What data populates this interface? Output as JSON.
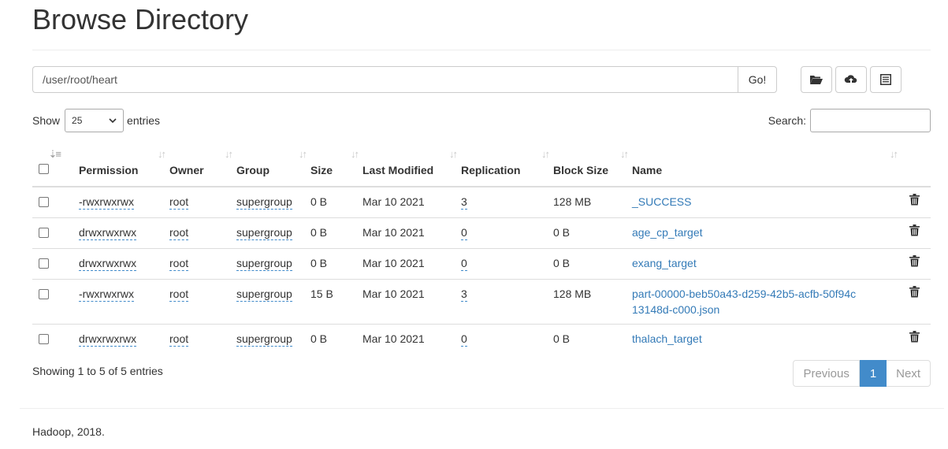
{
  "header": {
    "title": "Browse Directory"
  },
  "path": {
    "value": "/user/root/heart",
    "go_label": "Go!"
  },
  "toolbar": {
    "buttons": [
      {
        "icon": "folder-open-icon"
      },
      {
        "icon": "cloud-upload-icon"
      },
      {
        "icon": "list-alt-icon"
      }
    ]
  },
  "length": {
    "show_label": "Show",
    "selected": "25",
    "entries_label": "entries"
  },
  "search": {
    "label": "Search:",
    "value": ""
  },
  "table": {
    "columns": [
      "Permission",
      "Owner",
      "Group",
      "Size",
      "Last Modified",
      "Replication",
      "Block Size",
      "Name"
    ],
    "rows": [
      {
        "permission": "-rwxrwxrwx",
        "owner": "root",
        "group": "supergroup",
        "size": "0 B",
        "modified": "Mar 10 2021",
        "replication": "3",
        "block_size": "128 MB",
        "name": "_SUCCESS"
      },
      {
        "permission": "drwxrwxrwx",
        "owner": "root",
        "group": "supergroup",
        "size": "0 B",
        "modified": "Mar 10 2021",
        "replication": "0",
        "block_size": "0 B",
        "name": "age_cp_target"
      },
      {
        "permission": "drwxrwxrwx",
        "owner": "root",
        "group": "supergroup",
        "size": "0 B",
        "modified": "Mar 10 2021",
        "replication": "0",
        "block_size": "0 B",
        "name": "exang_target"
      },
      {
        "permission": "-rwxrwxrwx",
        "owner": "root",
        "group": "supergroup",
        "size": "15 B",
        "modified": "Mar 10 2021",
        "replication": "3",
        "block_size": "128 MB",
        "name": "part-00000-beb50a43-d259-42b5-acfb-50f94c13148d-c000.json"
      },
      {
        "permission": "drwxrwxrwx",
        "owner": "root",
        "group": "supergroup",
        "size": "0 B",
        "modified": "Mar 10 2021",
        "replication": "0",
        "block_size": "0 B",
        "name": "thalach_target"
      }
    ]
  },
  "info": {
    "text": "Showing 1 to 5 of 5 entries"
  },
  "pagination": {
    "previous": "Previous",
    "current": "1",
    "next": "Next"
  },
  "footer": {
    "text": "Hadoop, 2018."
  },
  "colors": {
    "accent": "#428bca",
    "link": "#337ab7"
  }
}
